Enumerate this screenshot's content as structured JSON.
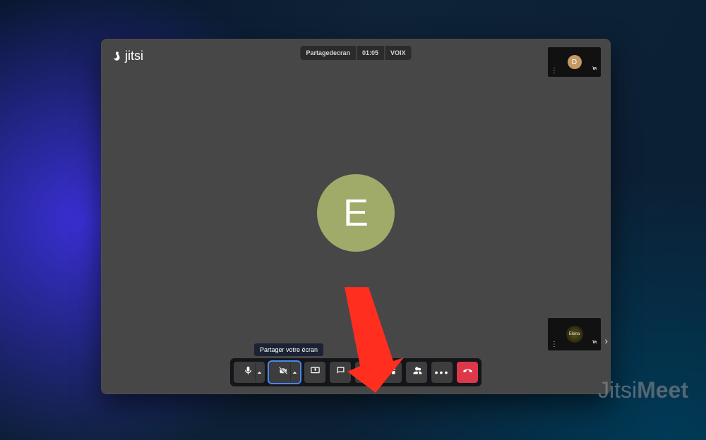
{
  "brand": {
    "name": "jitsi"
  },
  "header": {
    "room_name": "Partagedecran",
    "timer": "01:05",
    "speaker_label": "VOIX"
  },
  "participants": {
    "top_tile": {
      "initial": "D",
      "avatar_color": "#c49965"
    },
    "bottom_tile": {
      "name": "Elena"
    }
  },
  "main_stage": {
    "avatar_letter": "E",
    "avatar_color": "#a0ab6a"
  },
  "toolbar": {
    "mic_label": "Microphone",
    "camera_label": "Caméra",
    "share_label": "Partager votre écran",
    "chat_label": "Chat",
    "raise_hand_label": "Lever la main",
    "tile_view_label": "Vue mosaïque",
    "participants_label": "Participants",
    "more_label": "Plus d'actions",
    "hangup_label": "Quitter"
  },
  "tooltip": {
    "text": "Partager votre écran"
  },
  "watermark": {
    "part1": "Jitsi",
    "part2": "Meet"
  }
}
